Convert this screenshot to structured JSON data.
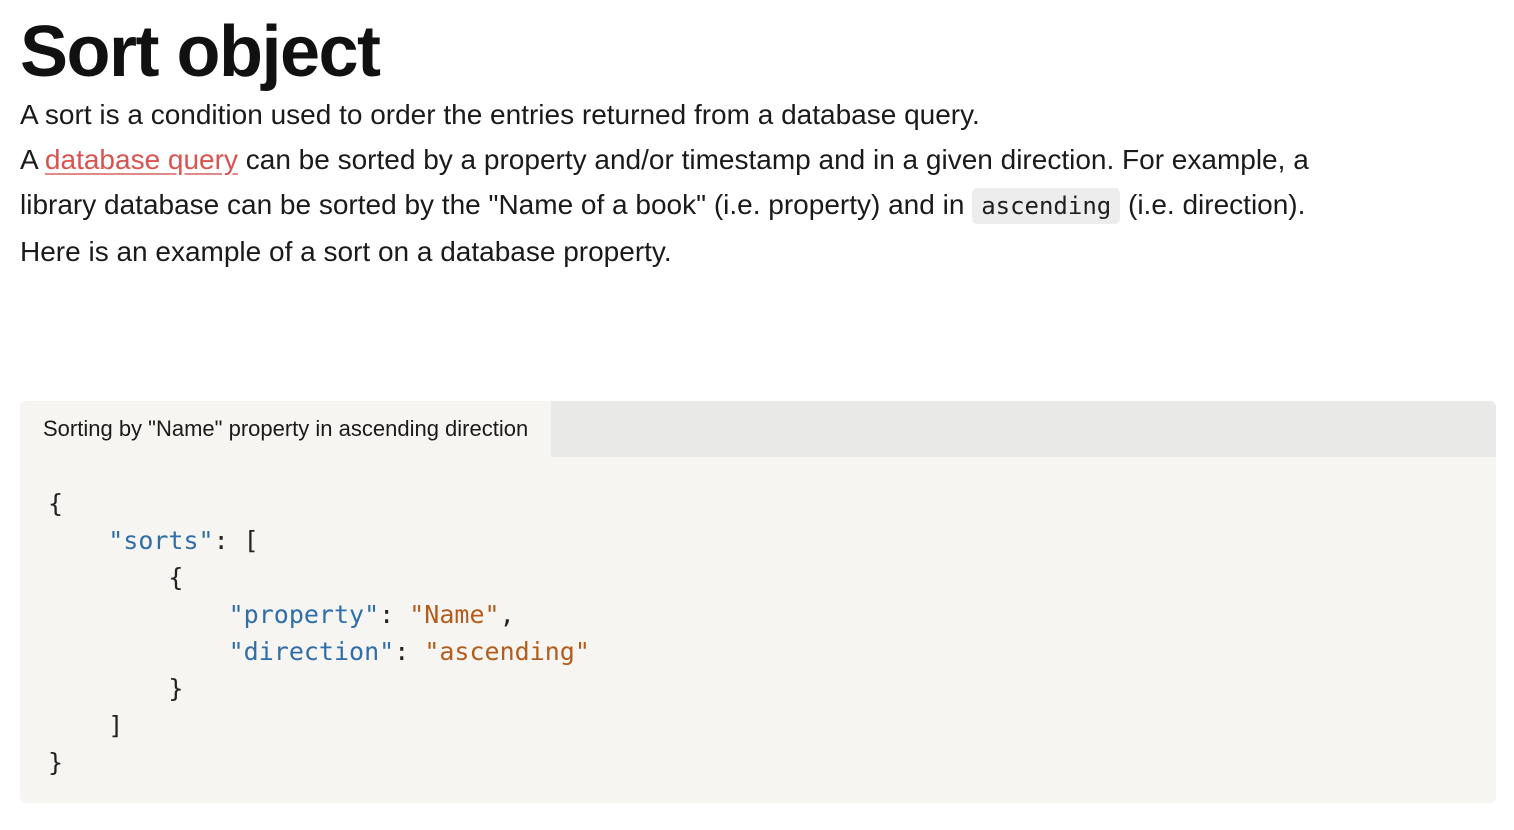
{
  "page": {
    "title": "Sort object",
    "para1": "A sort is a condition used to order the entries returned from a database query.",
    "para2": {
      "prefix": "A ",
      "link_text": "database query",
      "line1_rest": " can be sorted by a property and/or timestamp and in a given direction. For example, a",
      "line2_start": "library database can be sorted by the \"Name of a book\" (i.e. property) and in ",
      "code": "ascending",
      "line2_end": " (i.e. direction)."
    },
    "para3": "Here is an example of a sort on a database property."
  },
  "code_block": {
    "tab_label": "Sorting by \"Name\" property in ascending direction",
    "lines": {
      "open_brace": "{",
      "sorts_key": "\"sorts\"",
      "colon_bracket": ": [",
      "inner_open": "{",
      "property_key": "\"property\"",
      "colon1": ": ",
      "property_value": "\"Name\"",
      "comma": ",",
      "direction_key": "\"direction\"",
      "colon2": ": ",
      "direction_value": "\"ascending\"",
      "inner_close": "}",
      "close_bracket": "]",
      "close_brace": "}"
    }
  },
  "colors": {
    "link": "#d9534f",
    "json_key": "#2f6ea8",
    "json_string": "#b35d1c",
    "code_bg": "#f7f5f2",
    "tab_bar_bg": "#e9e9e8"
  }
}
